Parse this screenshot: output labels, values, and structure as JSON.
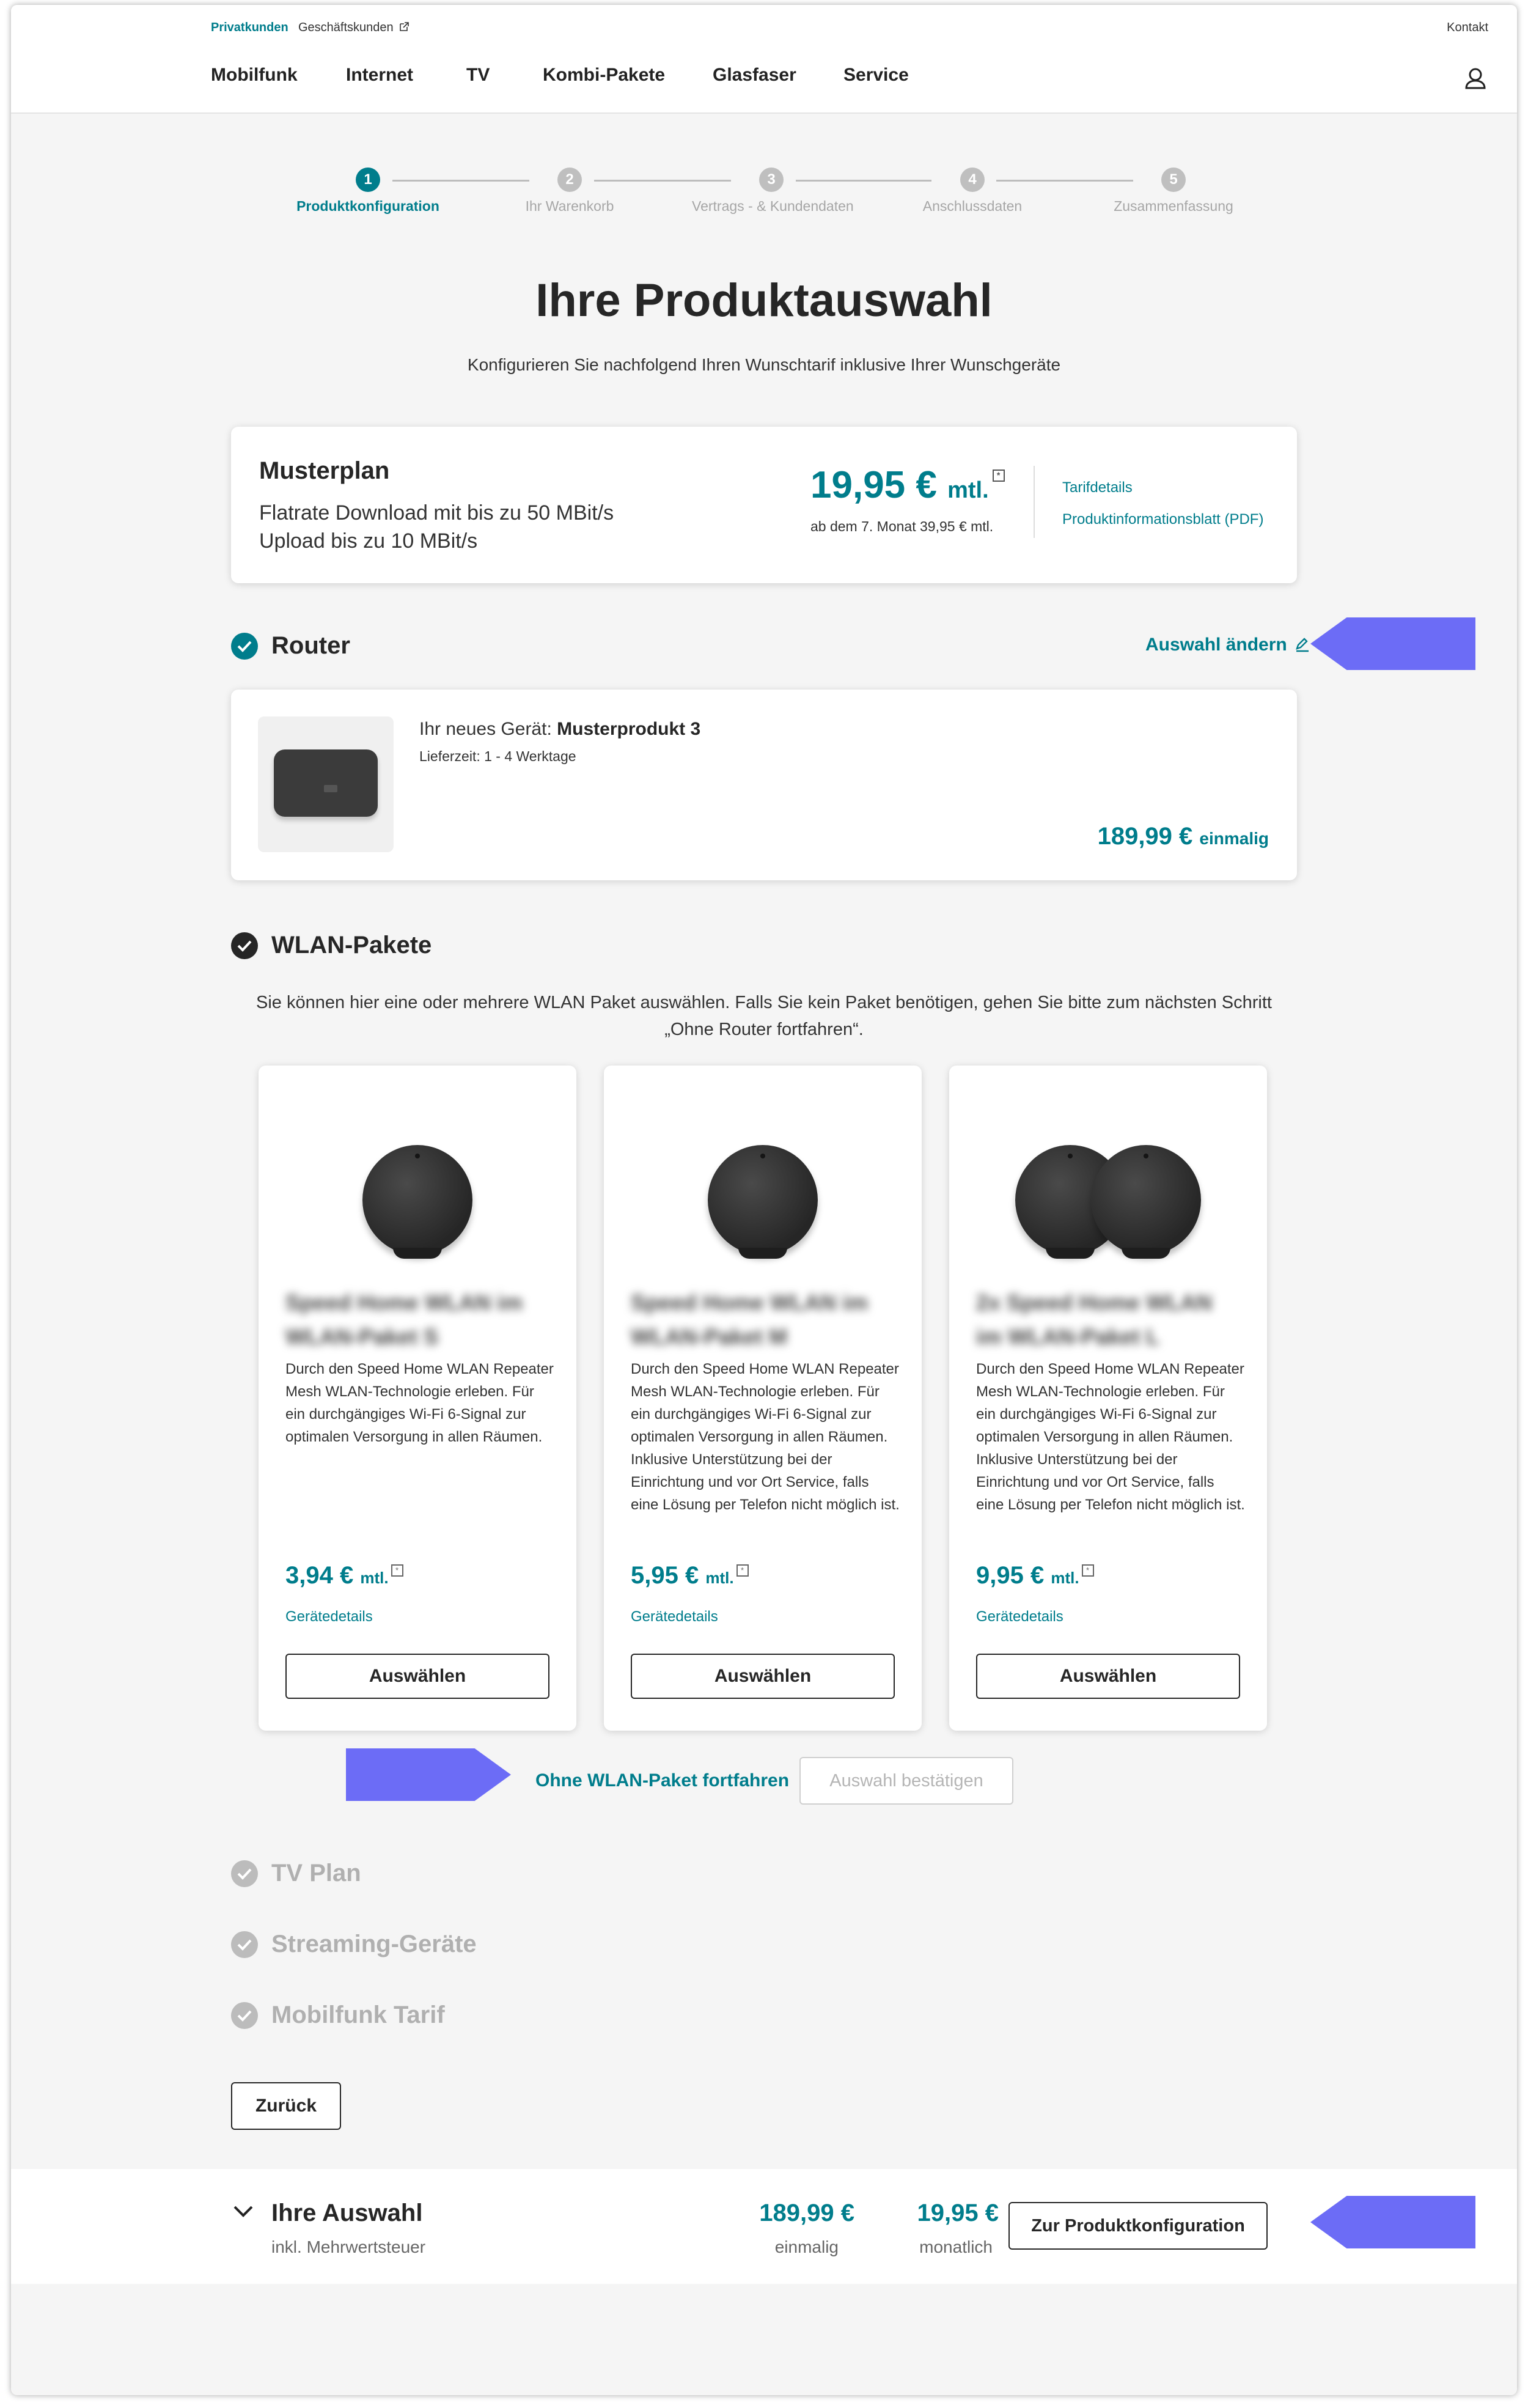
{
  "header": {
    "segment_private": "Privatkunden",
    "segment_business": "Geschäftskunden",
    "contact": "Kontakt",
    "nav": [
      "Mobilfunk",
      "Internet",
      "TV",
      "Kombi-Pakete",
      "Glasfaser",
      "Service"
    ]
  },
  "steps": [
    {
      "num": "1",
      "label": "Produktkonfiguration",
      "active": true
    },
    {
      "num": "2",
      "label": "Ihr Warenkorb",
      "active": false
    },
    {
      "num": "3",
      "label": "Vertrags - & Kundendaten",
      "active": false
    },
    {
      "num": "4",
      "label": "Anschlussdaten",
      "active": false
    },
    {
      "num": "5",
      "label": "Zusammenfassung",
      "active": false
    }
  ],
  "page": {
    "title": "Ihre Produktauswahl",
    "subtitle": "Konfigurieren Sie nachfolgend Ihren Wunschtarif inklusive Ihrer Wunschgeräte"
  },
  "plan": {
    "name": "Musterplan",
    "line1": "Flatrate Download mit bis zu 50 MBit/s",
    "line2": "Upload bis zu 10 MBit/s",
    "price": "19,95 €",
    "price_unit": "mtl.",
    "footnote_mark": "*",
    "after_note": "ab dem 7. Monat 39,95 € mtl.",
    "link_tariff": "Tarifdetails",
    "link_pdf": "Produktinformationsblatt (PDF)"
  },
  "router": {
    "section_title": "Router",
    "change_label": "Auswahl ändern",
    "new_device_prefix": "Ihr neues Gerät:",
    "device_name": "Musterprodukt 3",
    "delivery": "Lieferzeit: 1 - 4 Werktage",
    "price": "189,99 €",
    "price_unit": "einmalig"
  },
  "wlan": {
    "section_title": "WLAN-Pakete",
    "description": "Sie können hier eine oder mehrere WLAN Paket auswählen. Falls Sie kein Paket benötigen, gehen Sie bitte zum nächsten Schritt „Ohne Router fortfahren“.",
    "packages": [
      {
        "name_line1": "Speed Home WLAN im",
        "name_line2": "WLAN-Paket S",
        "description": "Durch den Speed Home WLAN Repeater Mesh WLAN-Technologie erleben. Für ein durchgängiges Wi-Fi 6-Signal zur optimalen Versorgung in allen Räumen.",
        "price": "3,94 €",
        "price_unit": "mtl.",
        "details": "Gerätedetails",
        "button": "Auswählen"
      },
      {
        "name_line1": "Speed Home WLAN im",
        "name_line2": "WLAN-Paket M",
        "description": "Durch den Speed Home WLAN Repeater Mesh WLAN-Technologie erleben. Für ein durchgängiges Wi-Fi 6-Signal zur optimalen Versorgung in allen Räumen. Inklusive Unterstützung bei der Einrichtung und vor Ort Service, falls eine Lösung per Telefon nicht möglich ist.",
        "price": "5,95 €",
        "price_unit": "mtl.",
        "details": "Gerätedetails",
        "button": "Auswählen"
      },
      {
        "name_line1": "2x Speed Home WLAN",
        "name_line2": "im WLAN-Paket L",
        "description": "Durch den Speed Home WLAN Repeater Mesh WLAN-Technologie erleben. Für ein durchgängiges Wi-Fi 6-Signal zur optimalen Versorgung in allen Räumen. Inklusive Unterstützung bei der Einrichtung und vor Ort Service, falls eine Lösung per Telefon nicht möglich ist.",
        "price": "9,95 €",
        "price_unit": "mtl.",
        "details": "Gerätedetails",
        "button": "Auswählen"
      }
    ],
    "skip_label": "Ohne WLAN-Paket fortfahren",
    "confirm_label": "Auswahl bestätigen"
  },
  "sections_pending": [
    "TV Plan",
    "Streaming-Geräte",
    "Mobilfunk Tarif"
  ],
  "back_label": "Zurück",
  "summary": {
    "title": "Ihre Auswahl",
    "vat_note": "inkl. Mehrwertsteuer",
    "one_time_price": "189,99 €",
    "one_time_label": "einmalig",
    "monthly_price": "19,95 €",
    "monthly_label": "monatlich",
    "button": "Zur Produktkonfiguration"
  },
  "colors": {
    "accent": "#007d8c",
    "annotation_arrow": "#6c6cf6",
    "check_done": "#007d8c",
    "check_current": "#262626",
    "check_pending": "#bcbcbc"
  }
}
